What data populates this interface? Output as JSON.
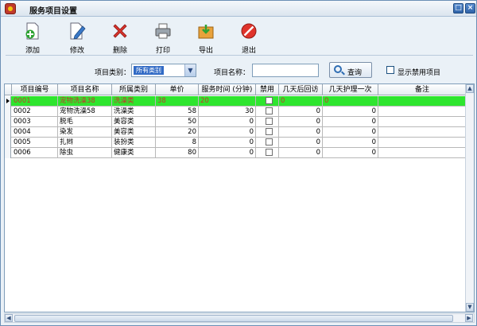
{
  "window": {
    "title": "服务项目设置"
  },
  "toolbar": {
    "add": "添加",
    "edit": "修改",
    "delete": "删除",
    "print": "打印",
    "export": "导出",
    "exit": "退出"
  },
  "filter": {
    "category_label": "项目类别：",
    "category_value": "所有类别",
    "name_label": "项目名称：",
    "name_value": "",
    "query_label": "查询",
    "show_disabled_label": "显示禁用项目"
  },
  "table": {
    "headers": [
      "项目编号",
      "项目名称",
      "所属类别",
      "单价",
      "服务时间 (分钟)",
      "禁用",
      "几天后回访",
      "几天护理一次",
      "备注"
    ],
    "rows": [
      [
        "0001",
        "宠物洗澡38",
        "洗澡类",
        "38",
        "20",
        "",
        "0",
        "0",
        ""
      ],
      [
        "0002",
        "宠物洗澡58",
        "洗澡类",
        "58",
        "30",
        "",
        "0",
        "0",
        ""
      ],
      [
        "0003",
        "脱毛",
        "美容类",
        "50",
        "0",
        "",
        "0",
        "0",
        ""
      ],
      [
        "0004",
        "染发",
        "美容类",
        "20",
        "0",
        "",
        "0",
        "0",
        ""
      ],
      [
        "0005",
        "扎辫",
        "装扮类",
        "8",
        "0",
        "",
        "0",
        "0",
        ""
      ],
      [
        "0006",
        "除虫",
        "健康类",
        "80",
        "0",
        "",
        "0",
        "0",
        ""
      ]
    ]
  },
  "colors": {
    "selected_row": "#2ee52e",
    "selected_text": "#c0392b",
    "accent": "#316ac5"
  }
}
